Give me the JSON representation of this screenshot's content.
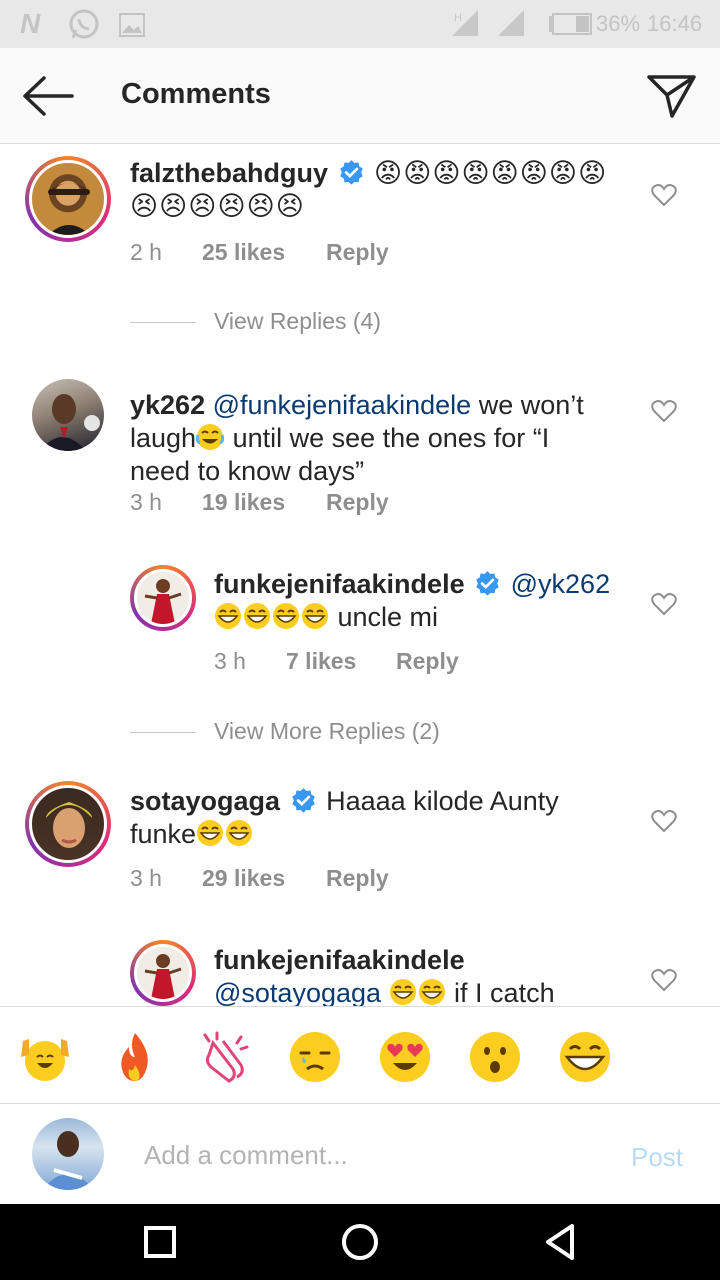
{
  "status_bar": {
    "icons": [
      "n-notification-icon",
      "whatsapp-icon",
      "image-icon",
      "signal-h-icon",
      "signal-icon",
      "battery-icon"
    ],
    "battery": "36%",
    "time": "16:46"
  },
  "header": {
    "title": "Comments",
    "back_icon": "arrow-left-icon",
    "send_icon": "paper-plane-icon"
  },
  "comments": [
    {
      "username": "falzthebahdguy",
      "verified": true,
      "body_emojis": "😡😡😡😡😡😡😡😡😣😣😣😣😣😣",
      "time": "2 h",
      "likes": "25 likes",
      "reply": "Reply"
    },
    {
      "username": "yk262",
      "mention": "@funkejenifaakindele",
      "text_1": " we won’t",
      "text_2": "laugh",
      "text_3": " until we see the ones for “I",
      "text_4": "need to know days”",
      "time": "3 h",
      "likes": "19 likes",
      "reply": "Reply"
    },
    {
      "username": "funkejenifaakindele",
      "verified": true,
      "mention": "@yk262",
      "text": " uncle mi",
      "time": "3 h",
      "likes": "7 likes",
      "reply": "Reply"
    },
    {
      "username": "sotayogaga",
      "verified": true,
      "text_1": " Haaaa kilode Aunty",
      "text_2": "funke",
      "time": "3 h",
      "likes": "29 likes",
      "reply": "Reply"
    },
    {
      "username": "funkejenifaakindele",
      "mention": "@sotayogaga",
      "text": " if I catch"
    }
  ],
  "view_replies": "View Replies (4)",
  "view_more_replies": "View More Replies (2)",
  "emoji_bar": [
    "raising-hands-emoji",
    "fire-emoji",
    "clapping-hands-emoji",
    "crying-face-emoji",
    "heart-eyes-emoji",
    "surprised-face-emoji",
    "laughing-tears-emoji"
  ],
  "composer": {
    "placeholder": "Add a comment...",
    "post_label": "Post"
  },
  "nav_bar": [
    "square-recents-icon",
    "circle-home-icon",
    "triangle-back-icon"
  ],
  "colors": {
    "mention": "#0b3a72",
    "verified": "#3897f0",
    "meta": "#8e8e8e",
    "post_disabled": "#b9daf7",
    "story_ring": "#dd2a7b"
  }
}
